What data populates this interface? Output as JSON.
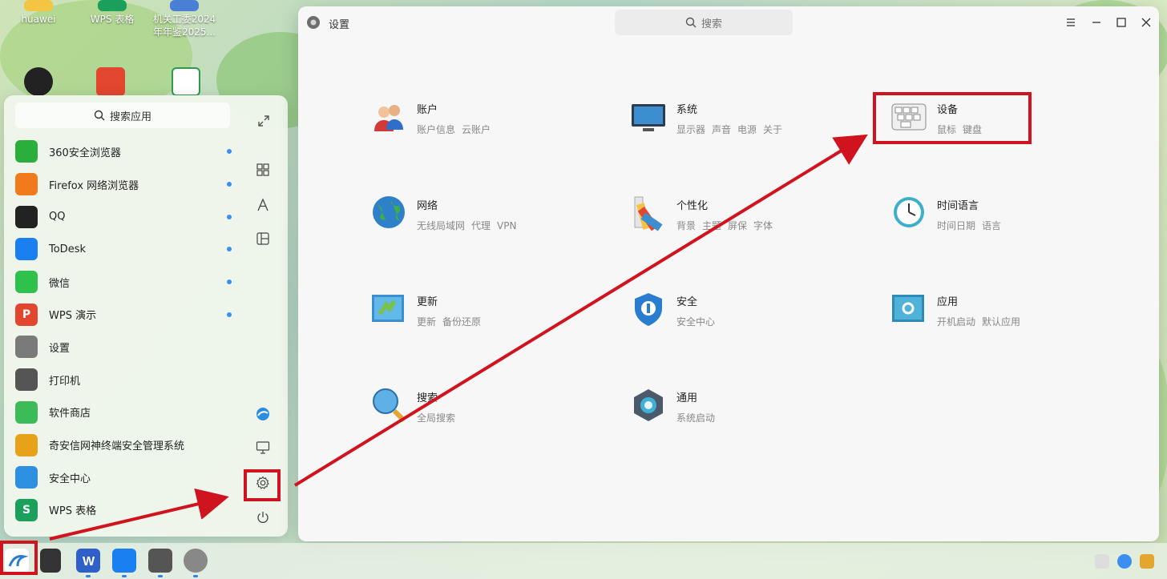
{
  "desktop": {
    "icons": [
      {
        "label": "huawei"
      },
      {
        "label": "WPS 表格"
      },
      {
        "label_line1": "机关工委2024",
        "label_line2": "年年鉴2025..."
      }
    ]
  },
  "start_menu": {
    "search_placeholder": "搜索应用",
    "apps": [
      {
        "label": "360安全浏览器",
        "icon": "browser-360-icon",
        "color": "#2aae3c"
      },
      {
        "label": "Firefox 网络浏览器",
        "icon": "firefox-icon",
        "color": "#f07a1c"
      },
      {
        "label": "QQ",
        "icon": "qq-icon",
        "color": "#222222"
      },
      {
        "label": "ToDesk",
        "icon": "todesk-icon",
        "color": "#1a7ff0"
      },
      {
        "label": "微信",
        "icon": "wechat-icon",
        "color": "#2ec14b"
      },
      {
        "label": "WPS 演示",
        "icon": "wps-presentation-icon",
        "color": "#e2462f",
        "glyph": "P"
      },
      {
        "label": "设置",
        "icon": "settings-icon",
        "color": "#7a7a7a"
      },
      {
        "label": "打印机",
        "icon": "printer-icon",
        "color": "#555555"
      },
      {
        "label": "软件商店",
        "icon": "software-store-icon",
        "color": "#3cbc59"
      },
      {
        "label": "奇安信网神终端安全管理系统",
        "icon": "qianxin-icon",
        "color": "#e8a21a"
      },
      {
        "label": "安全中心",
        "icon": "security-center-icon",
        "color": "#2d8fe0"
      },
      {
        "label": "WPS 表格",
        "icon": "wps-spreadsheet-icon",
        "color": "#1aa05a",
        "glyph": "S"
      }
    ]
  },
  "settings": {
    "title": "设置",
    "search_placeholder": "搜索",
    "categories": [
      {
        "title": "账户",
        "subs": [
          "账户信息",
          "云账户"
        ]
      },
      {
        "title": "系统",
        "subs": [
          "显示器",
          "声音",
          "电源",
          "关于"
        ]
      },
      {
        "title": "设备",
        "subs": [
          "鼠标",
          "键盘"
        ]
      },
      {
        "title": "网络",
        "subs": [
          "无线局域网",
          "代理",
          "VPN"
        ]
      },
      {
        "title": "个性化",
        "subs": [
          "背景",
          "主题",
          "屏保",
          "字体"
        ]
      },
      {
        "title": "时间语言",
        "subs": [
          "时间日期",
          "语言"
        ]
      },
      {
        "title": "更新",
        "subs": [
          "更新",
          "备份还原"
        ]
      },
      {
        "title": "安全",
        "subs": [
          "安全中心"
        ]
      },
      {
        "title": "应用",
        "subs": [
          "开机启动",
          "默认应用"
        ]
      },
      {
        "title": "搜索",
        "subs": [
          "全局搜索"
        ]
      },
      {
        "title": "通用",
        "subs": [
          "系统启动"
        ]
      }
    ]
  },
  "colors": {
    "annotation_red": "#d0141f",
    "accent_blue": "#3b8ff0"
  }
}
